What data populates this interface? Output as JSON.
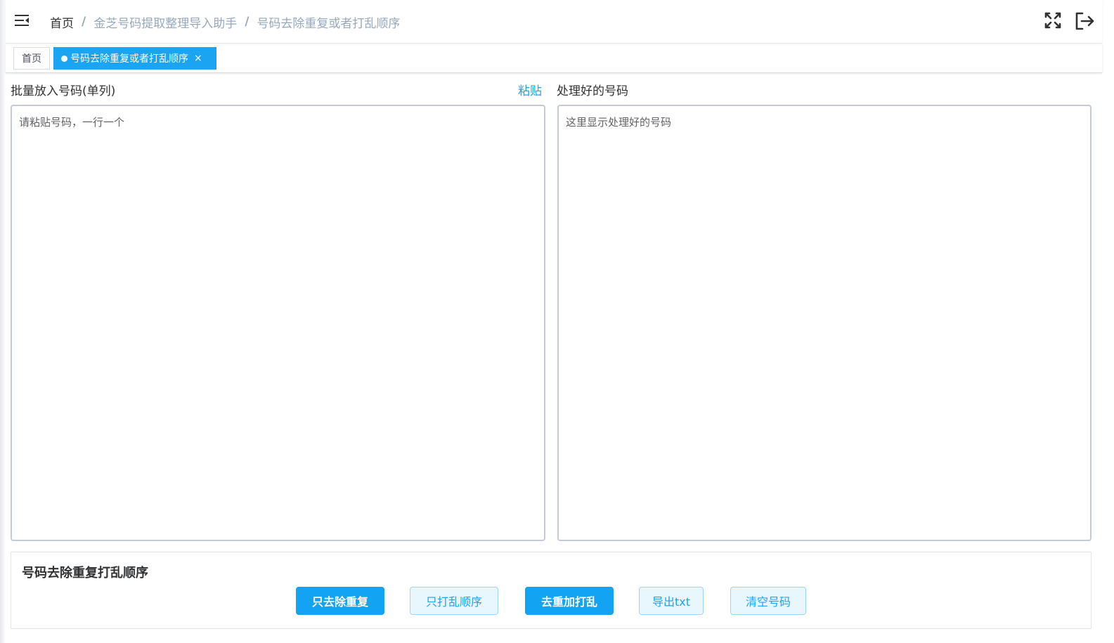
{
  "header": {
    "breadcrumb": [
      {
        "label": "首页"
      },
      {
        "label": "金芝号码提取整理导入助手"
      },
      {
        "label": "号码去除重复或者打乱顺序"
      }
    ],
    "separator": "/"
  },
  "tags": {
    "home": "首页",
    "active": "号码去除重复或者打乱顺序",
    "close_glyph": "×"
  },
  "input": {
    "label": "批量放入号码(单列)",
    "paste_link": "粘贴",
    "placeholder": "请粘贴号码，一行一个",
    "value": ""
  },
  "output": {
    "label": "处理好的号码",
    "placeholder": "这里显示处理好的号码",
    "value": ""
  },
  "panel": {
    "title": "号码去除重复打乱顺序",
    "buttons": {
      "dedupe": "只去除重复",
      "shuffle": "只打乱顺序",
      "dedupe_shuffle": "去重加打乱",
      "export": "导出txt",
      "clear": "清空号码"
    }
  },
  "colors": {
    "accent": "#1aa4f2",
    "muted_text": "#97a8be",
    "plain_button_bg": "#e8f6fe"
  },
  "icons": {
    "menu": "hamburger-icon",
    "fullscreen": "fullscreen-icon",
    "logout": "logout-icon",
    "tag_dot": "dot-icon",
    "tag_close": "close-icon"
  }
}
